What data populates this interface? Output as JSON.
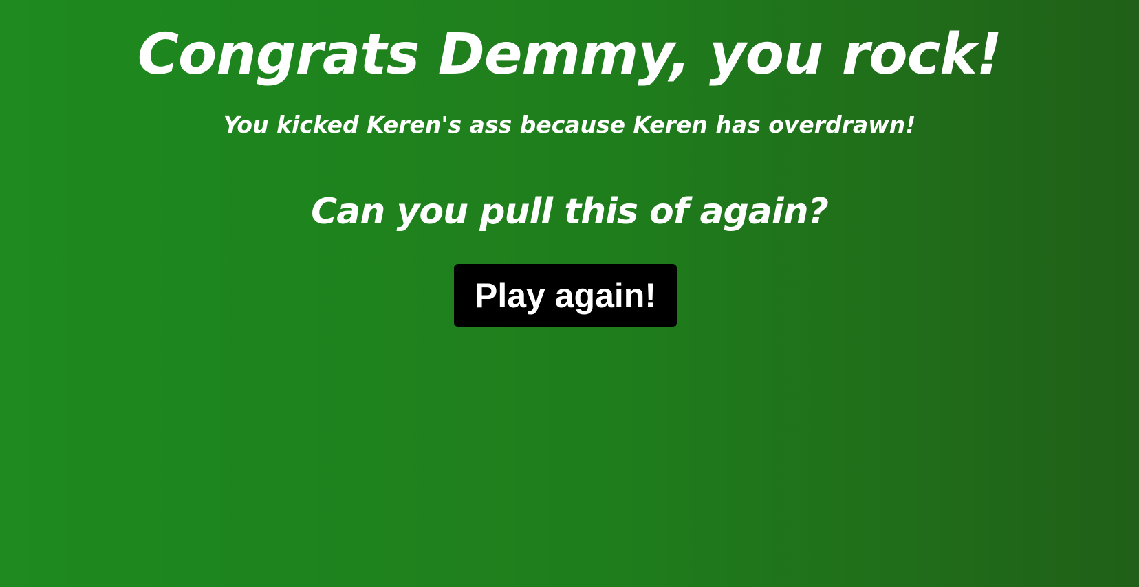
{
  "result_screen": {
    "title": "Congrats Demmy, you rock!",
    "subtitle": "You kicked Keren's ass because Keren has overdrawn!",
    "question": "Can you pull this of again?",
    "play_again_label": "Play again!"
  },
  "colors": {
    "background_left": "#1e8a1f",
    "background_right": "#206018",
    "text": "#ffffff",
    "button_background": "#000000"
  }
}
